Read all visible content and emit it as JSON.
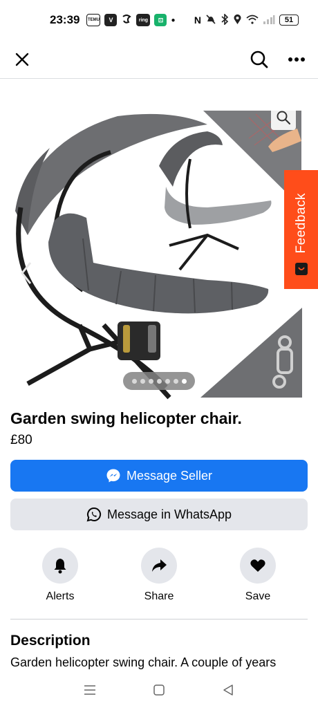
{
  "status_bar": {
    "time": "23:39",
    "app_icons": [
      "temu-icon",
      "v-app-icon",
      "swirl-app-icon",
      "ring-app-icon",
      "green-app-icon"
    ],
    "app_labels": {
      "temu": "TEMU",
      "v": "V",
      "ring": "ring"
    },
    "battery": "51"
  },
  "nav": {
    "close": "close-icon",
    "search": "search-icon",
    "more": "more-icon"
  },
  "gallery": {
    "dot_count": 7,
    "active_dot": 6
  },
  "feedback": {
    "label": "Feedback"
  },
  "listing": {
    "title": "Garden swing helicopter chair.",
    "price": "£80"
  },
  "buttons": {
    "message_seller": "Message Seller",
    "message_whatsapp": "Message in WhatsApp"
  },
  "actions": [
    {
      "label": "Alerts",
      "icon": "bell-icon"
    },
    {
      "label": "Share",
      "icon": "share-icon"
    },
    {
      "label": "Save",
      "icon": "heart-icon"
    }
  ],
  "description": {
    "heading": "Description",
    "text": "Garden helicopter swing chair. A couple of years"
  },
  "colors": {
    "primary": "#1877f2",
    "secondary": "#e4e6eb",
    "feedback": "#ff4d1a"
  }
}
